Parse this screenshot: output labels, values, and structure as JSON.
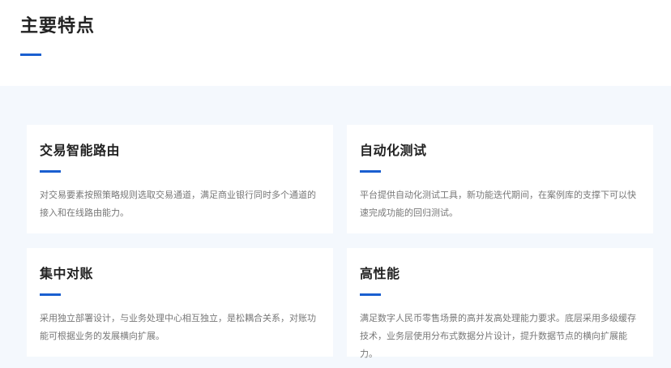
{
  "section": {
    "title": "主要特点"
  },
  "features": [
    {
      "title": "交易智能路由",
      "desc": "对交易要素按照策略规则选取交易通道，满足商业银行同时多个通道的接入和在线路由能力。"
    },
    {
      "title": "自动化测试",
      "desc": "平台提供自动化测试工具，新功能迭代期间，在案例库的支撑下可以快速完成功能的回归测试。"
    },
    {
      "title": "集中对账",
      "desc": "采用独立部署设计，与业务处理中心相互独立，是松耦合关系，对账功能可根据业务的发展横向扩展。"
    },
    {
      "title": "高性能",
      "desc": "满足数字人民币零售场景的高并发高处理能力要求。底层采用多级缓存技术，业务层使用分布式数据分片设计，提升数据节点的横向扩展能力。"
    }
  ],
  "colors": {
    "accent": "#1a5fd0",
    "section_bg": "#f4f8fd",
    "title": "#222222",
    "desc": "#777777"
  }
}
